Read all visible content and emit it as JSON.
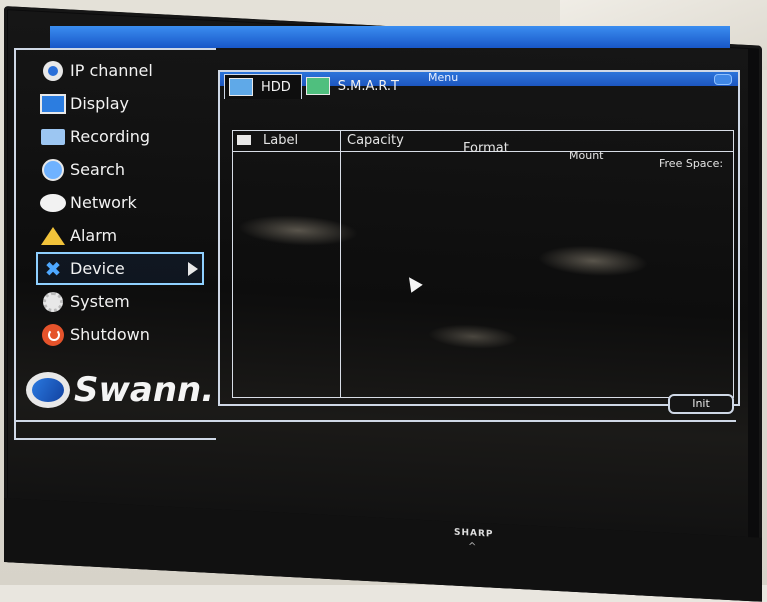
{
  "sidebar": {
    "items": [
      {
        "label": "IP channel",
        "icon": "ip-camera-icon"
      },
      {
        "label": "Display",
        "icon": "display-icon"
      },
      {
        "label": "Recording",
        "icon": "recording-icon"
      },
      {
        "label": "Search",
        "icon": "search-icon"
      },
      {
        "label": "Network",
        "icon": "network-icon"
      },
      {
        "label": "Alarm",
        "icon": "alarm-icon"
      },
      {
        "label": "Device",
        "icon": "device-icon",
        "selected": true
      },
      {
        "label": "System",
        "icon": "gear-icon"
      },
      {
        "label": "Shutdown",
        "icon": "power-icon"
      }
    ],
    "logo_text": "Swann."
  },
  "panel": {
    "title": "Menu",
    "tabs": [
      {
        "label": "HDD",
        "active": true
      },
      {
        "label": "S.M.A.R.T",
        "active": false
      }
    ],
    "columns": [
      "Label",
      "Capacity",
      "Format",
      "Mount",
      "Free Space:"
    ],
    "init_label": "Init"
  },
  "tv": {
    "brand": "SHARP",
    "indicator": "^"
  },
  "colors": {
    "accent_blue": "#1d56c0",
    "selection_border": "#8fd0ff",
    "alarm_yellow": "#f2c33a",
    "shutdown_red": "#e5532b"
  }
}
